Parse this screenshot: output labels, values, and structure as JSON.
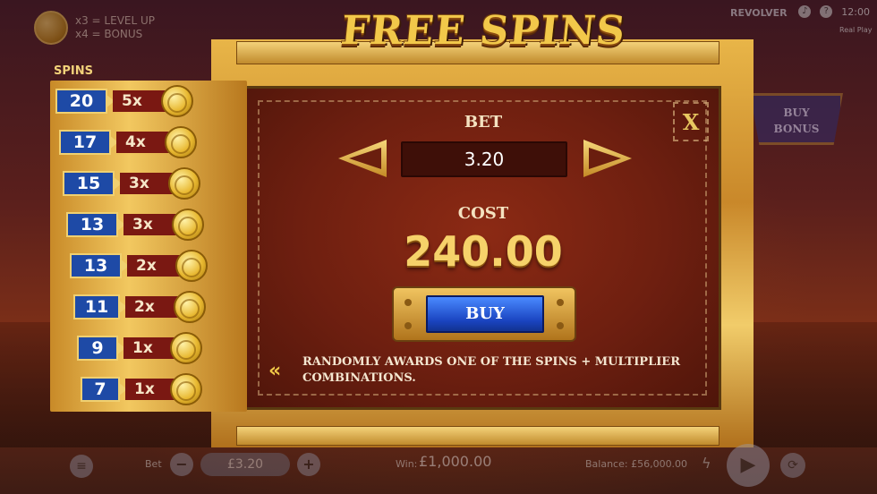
{
  "info": {
    "line1": "x3 = LEVEL UP",
    "line2": "x4 = BONUS"
  },
  "brand": {
    "name": "REVOLVER",
    "mode": "Real Play",
    "time": "12:00"
  },
  "title": "FREE SPINS",
  "buy_bonus": {
    "line1": "BUY",
    "line2": "BONUS"
  },
  "spins_table": {
    "header": "SPINS",
    "rows": [
      {
        "spins": "20",
        "mult": "5x"
      },
      {
        "spins": "17",
        "mult": "4x"
      },
      {
        "spins": "15",
        "mult": "3x"
      },
      {
        "spins": "13",
        "mult": "3x"
      },
      {
        "spins": "13",
        "mult": "2x"
      },
      {
        "spins": "11",
        "mult": "2x"
      },
      {
        "spins": "9",
        "mult": "1x"
      },
      {
        "spins": "7",
        "mult": "1x"
      }
    ]
  },
  "dialog": {
    "close": "X",
    "bet_label": "BET",
    "bet_value": "3.20",
    "cost_label": "COST",
    "cost_value": "240.00",
    "buy_label": "BUY",
    "description": "RANDOMLY AWARDS ONE OF THE SPINS + MULTIPLIER COMBINATIONS."
  },
  "bottom_bar": {
    "bet_label": "Bet",
    "bet_value": "£3.20",
    "win_label": "Win:",
    "win_value": "£1,000.00",
    "balance_label": "Balance: £56,000.00"
  },
  "colors": {
    "gold": "#f2c84a",
    "leather": "#7a2212",
    "blue": "#1e4aa6"
  }
}
